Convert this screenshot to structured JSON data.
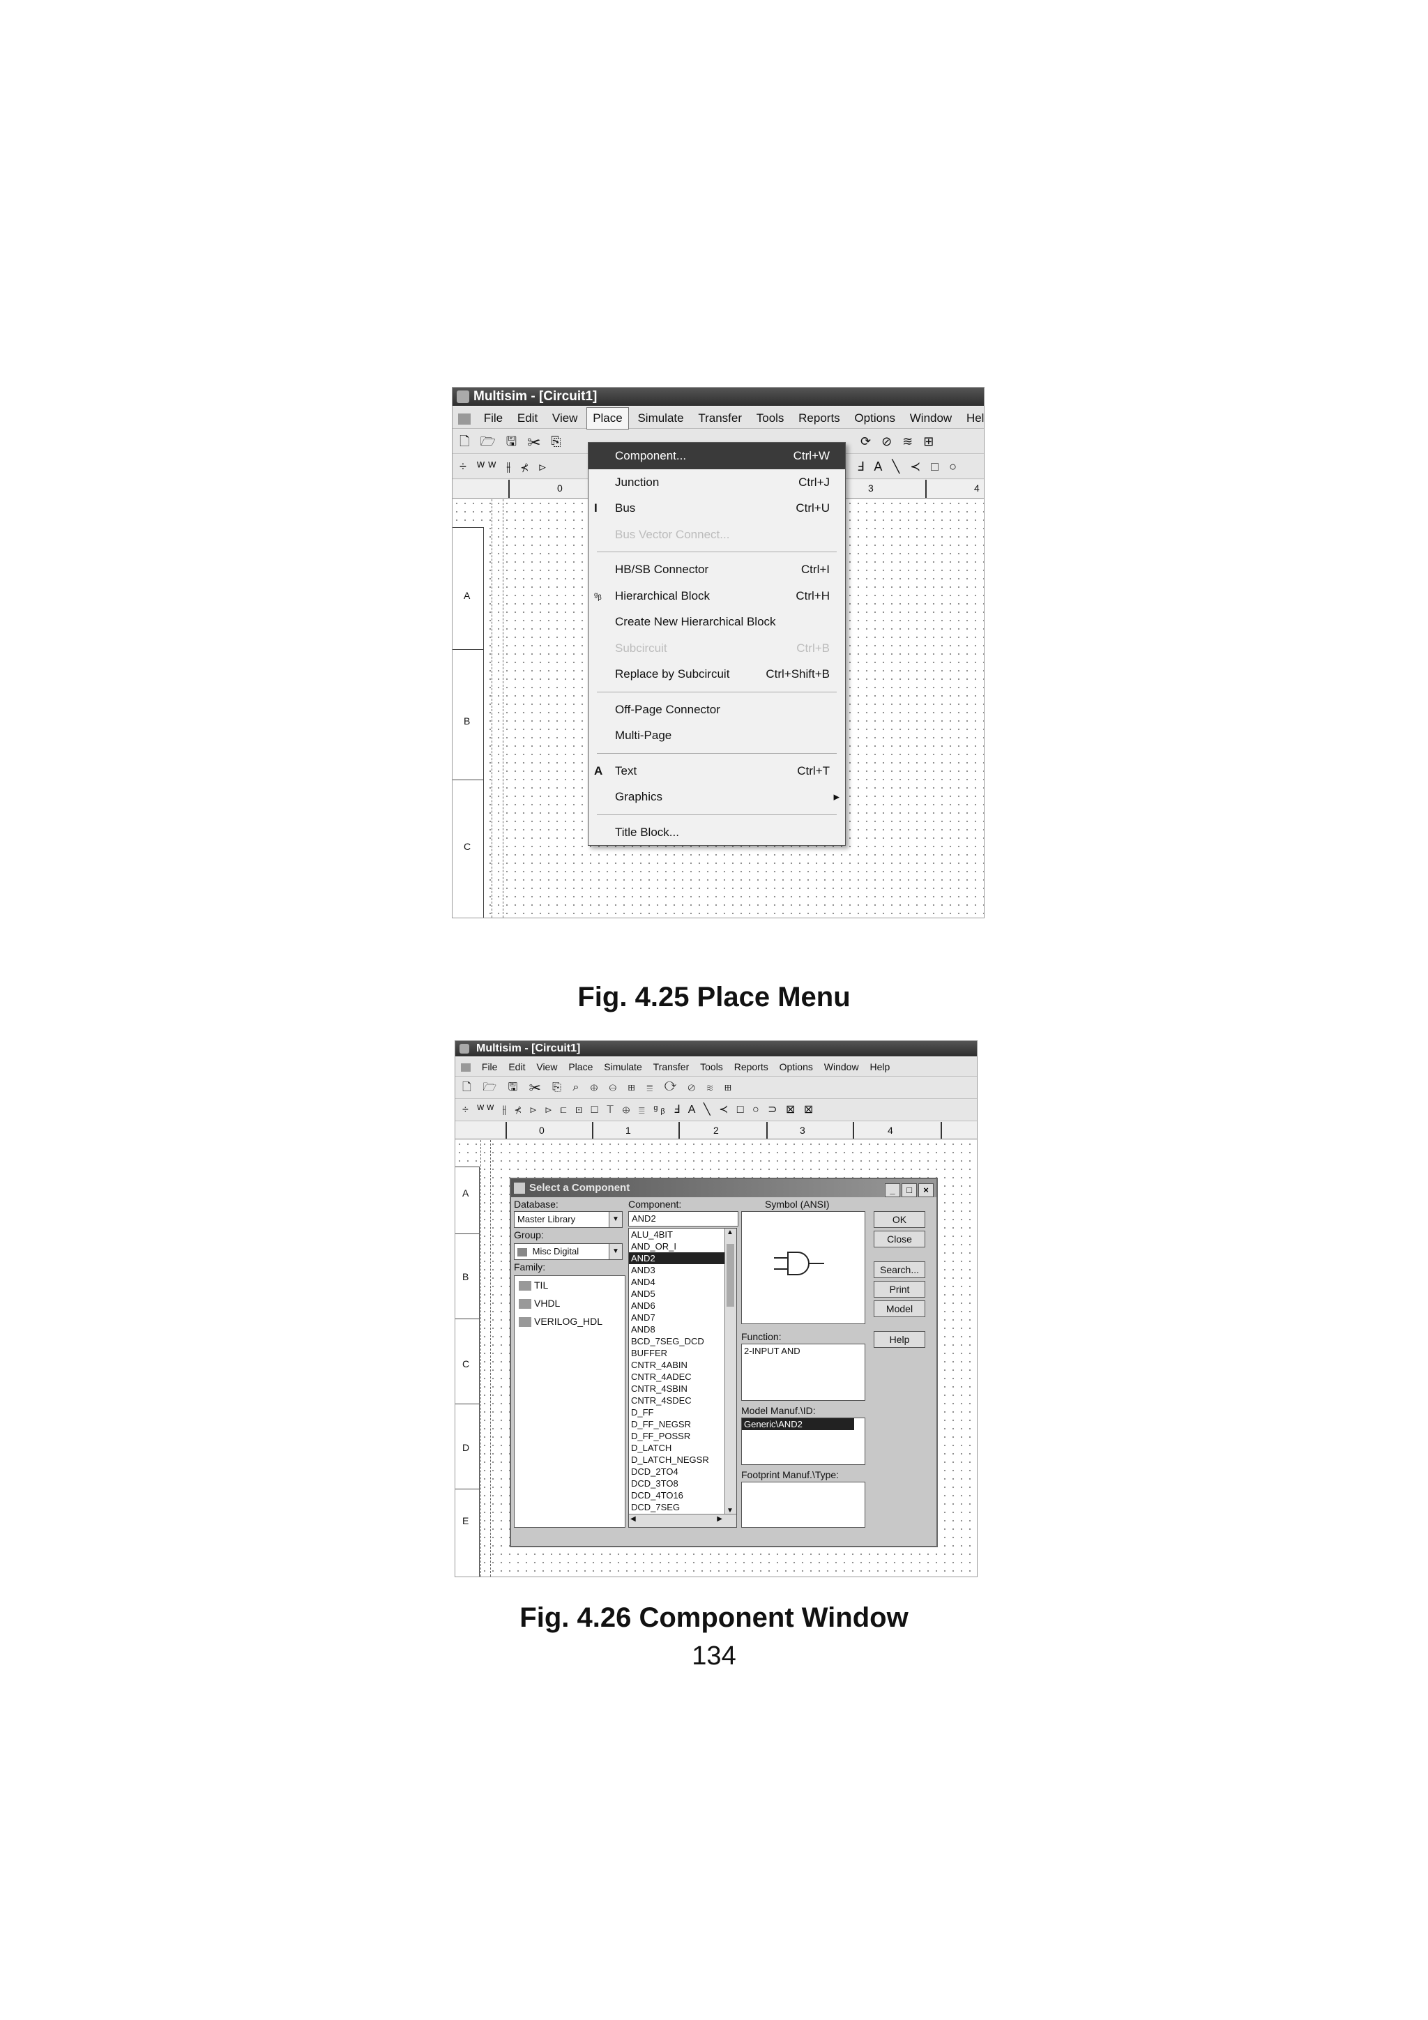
{
  "figure1": {
    "window_title": "Multisim - [Circuit1]",
    "menus": [
      "File",
      "Edit",
      "View",
      "Place",
      "Simulate",
      "Transfer",
      "Tools",
      "Reports",
      "Options",
      "Window",
      "Help"
    ],
    "active_menu": "Place",
    "toolbar_row1": "🗋 🗁 🖫 ✂ ⎘",
    "toolbar_row1_right": "⟳ ⊘ ≋ ⊞",
    "toolbar_row2": "÷ ᵂᵂ ⫲ ⊀ ⊳",
    "toolbar_row2_right": "Ⅎ A ╲ ≺ □ ○",
    "ruler_labels": [
      "0",
      "3",
      "4"
    ],
    "row_labels": [
      "A",
      "B",
      "C"
    ],
    "place_menu": [
      {
        "label": "Component...",
        "shortcut": "Ctrl+W",
        "state": "highlighted",
        "glyph": ""
      },
      {
        "label": "Junction",
        "shortcut": "Ctrl+J",
        "state": "normal",
        "glyph": ""
      },
      {
        "label": "Bus",
        "shortcut": "Ctrl+U",
        "state": "normal",
        "glyph": "Ɩ"
      },
      {
        "label": "Bus Vector Connect...",
        "shortcut": "",
        "state": "disabled",
        "glyph": ""
      },
      {
        "label": "HB/SB Connector",
        "shortcut": "Ctrl+I",
        "state": "normal",
        "glyph": ""
      },
      {
        "label": "Hierarchical Block",
        "shortcut": "Ctrl+H",
        "state": "normal",
        "glyph": "ᵍᵦ"
      },
      {
        "label": "Create New Hierarchical Block",
        "shortcut": "",
        "state": "normal",
        "glyph": ""
      },
      {
        "label": "Subcircuit",
        "shortcut": "Ctrl+B",
        "state": "disabled",
        "glyph": ""
      },
      {
        "label": "Replace by Subcircuit",
        "shortcut": "Ctrl+Shift+B",
        "state": "normal",
        "glyph": ""
      },
      {
        "label": "Off-Page Connector",
        "shortcut": "",
        "state": "normal",
        "glyph": ""
      },
      {
        "label": "Multi-Page",
        "shortcut": "",
        "state": "normal",
        "glyph": ""
      },
      {
        "label": "Text",
        "shortcut": "Ctrl+T",
        "state": "normal",
        "glyph": "A"
      },
      {
        "label": "Graphics",
        "shortcut": "",
        "state": "submenu",
        "glyph": ""
      },
      {
        "label": "Title Block...",
        "shortcut": "",
        "state": "normal",
        "glyph": ""
      }
    ],
    "caption": "Fig. 4.25  Place Menu"
  },
  "figure2": {
    "window_title": "Multisim - [Circuit1]",
    "menus": [
      "File",
      "Edit",
      "View",
      "Place",
      "Simulate",
      "Transfer",
      "Tools",
      "Reports",
      "Options",
      "Window",
      "Help"
    ],
    "toolbar_row1": "🗋 🗁 🖫 ✂ ⎘ ⌕ ⊕ ⊖ ⊞ ≣ ⟳ ⊘ ≋ ⊞",
    "toolbar_row2": "÷ ᵂᵂ ⫲ ⊀ ⊳ ⊳ ⊏ ⊡ □ ⊤ ⊕ ≣ ᵍᵦ Ⅎ A ╲ ≺ □ ○ ⊃ ⊠ ⊠",
    "ruler_labels": [
      "0",
      "1",
      "2",
      "3",
      "4"
    ],
    "row_labels": [
      "A",
      "B",
      "C",
      "D",
      "E"
    ],
    "dialog": {
      "title": "Select a Component",
      "win_buttons": [
        "_",
        "□",
        "×"
      ],
      "database_label": "Database:",
      "database_value": "Master Library",
      "group_label": "Group:",
      "group_value": "Misc Digital",
      "family_label": "Family:",
      "families": [
        "TIL",
        "VHDL",
        "VERILOG_HDL"
      ],
      "component_label": "Component:",
      "component_value": "AND2",
      "components": [
        "ALU_4BIT",
        "AND_OR_I",
        "AND2",
        "AND3",
        "AND4",
        "AND5",
        "AND6",
        "AND7",
        "AND8",
        "BCD_7SEG_DCD",
        "BUFFER",
        "CNTR_4ABIN",
        "CNTR_4ADEC",
        "CNTR_4SBIN",
        "CNTR_4SDEC",
        "D_FF",
        "D_FF_NEGSR",
        "D_FF_POSSR",
        "D_LATCH",
        "D_LATCH_NEGSR",
        "DCD_2TO4",
        "DCD_3TO8",
        "DCD_4TO16",
        "DCD_7SEG"
      ],
      "selected_component": "AND2",
      "symbol_label": "Symbol (ANSI)",
      "function_label": "Function:",
      "function_value": "2-INPUT AND",
      "model_label": "Model Manuf.\\ID:",
      "model_value": "Generic\\AND2",
      "footprint_label": "Footprint Manuf.\\Type:",
      "buttons": [
        "OK",
        "Close",
        "Search...",
        "Print",
        "Model",
        "Help"
      ]
    },
    "caption": "Fig. 4.26  Component Window"
  },
  "page_number": "134"
}
